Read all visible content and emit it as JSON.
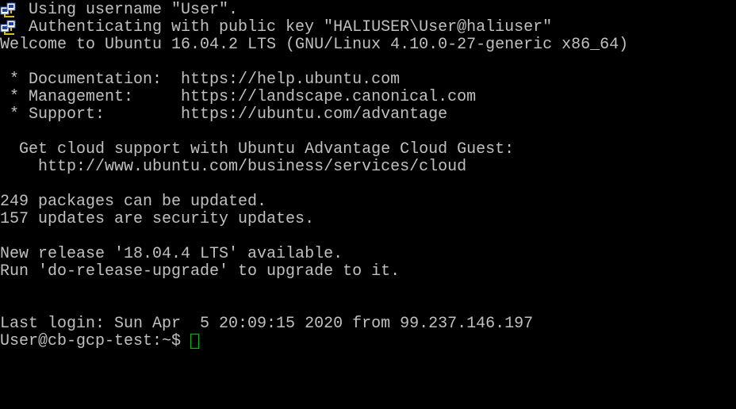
{
  "terminal": {
    "auth_lines": [
      "Using username \"User\".",
      "Authenticating with public key \"HALIUSER\\User@haliuser\""
    ],
    "lines": [
      "Welcome to Ubuntu 16.04.2 LTS (GNU/Linux 4.10.0-27-generic x86_64)",
      "",
      " * Documentation:  https://help.ubuntu.com",
      " * Management:     https://landscape.canonical.com",
      " * Support:        https://ubuntu.com/advantage",
      "",
      "  Get cloud support with Ubuntu Advantage Cloud Guest:",
      "    http://www.ubuntu.com/business/services/cloud",
      "",
      "249 packages can be updated.",
      "157 updates are security updates.",
      "",
      "New release '18.04.4 LTS' available.",
      "Run 'do-release-upgrade' to upgrade to it.",
      "",
      "",
      "Last login: Sun Apr  5 20:09:15 2020 from 99.237.146.197"
    ],
    "prompt": "User@cb-gcp-test:~$ ",
    "icon_name": "putty-key-icon",
    "colors": {
      "background": "#000000",
      "text": "#c0c0c0",
      "cursor": "#00c000"
    }
  }
}
